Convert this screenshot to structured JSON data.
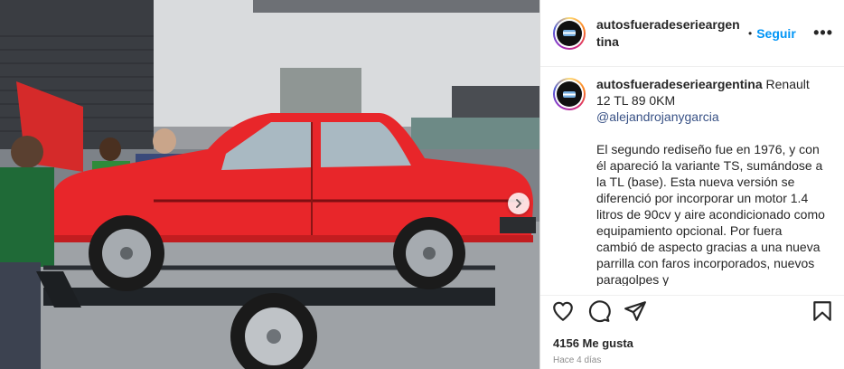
{
  "header": {
    "username": "autosfueradeserieargentina",
    "dot": "•",
    "follow_label": "Seguir",
    "more_label": "•••"
  },
  "caption": {
    "username": "autosfueradeserieargentina",
    "title": "Renault 12 TL 89 0KM",
    "mention": "@alejandrojanygarcia",
    "text": "El segundo rediseño fue en 1976, y con él apareció la variante TS, sumándose a la TL (base). Esta nueva versión se diferenció por incorporar un motor 1.4 litros de 90cv y aire acondicionado como equipamiento opcional. Por fuera cambió de aspecto gracias a una nueva parrilla con faros incorporados, nuevos paragolpes y"
  },
  "engagement": {
    "likes_label": "4156 Me gusta",
    "time_label": "Hace 4 días"
  },
  "icons": {
    "like": "heart-icon",
    "comment": "comment-icon",
    "share": "send-icon",
    "save": "bookmark-icon",
    "next": "chevron-right-icon",
    "more": "more-icon"
  },
  "colors": {
    "follow": "#0095f6",
    "mention": "#385185",
    "car_red": "#e8262a"
  }
}
